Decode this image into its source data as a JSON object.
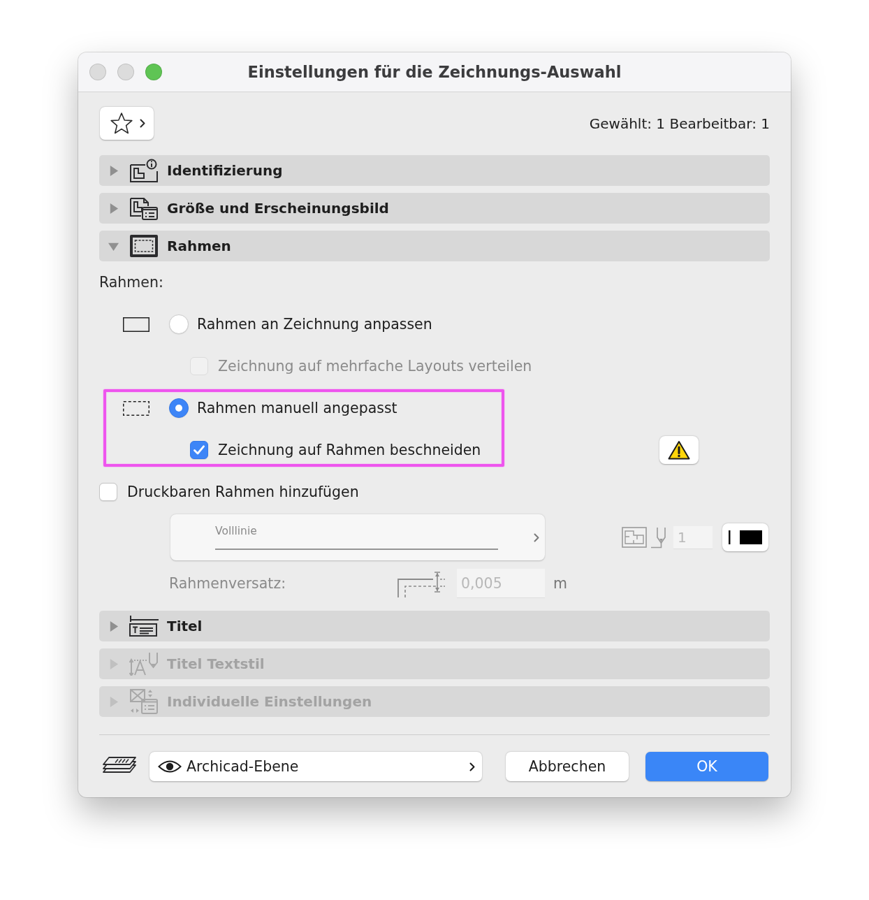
{
  "window": {
    "title": "Einstellungen für die Zeichnungs-Auswahl",
    "controls": [
      {
        "kind": "close",
        "disabled": true
      },
      {
        "kind": "minimize",
        "disabled": true
      },
      {
        "kind": "zoom",
        "disabled": false
      }
    ]
  },
  "toolbar": {
    "selection_count": "Gewählt: 1 Bearbeitbar: 1"
  },
  "sections": [
    {
      "kind": "identification",
      "title": "Identifizierung",
      "expanded": false,
      "disabled": false
    },
    {
      "kind": "appearance",
      "title": "Größe und Erscheinungsbild",
      "expanded": false,
      "disabled": false
    },
    {
      "kind": "frame",
      "title": "Rahmen",
      "expanded": true,
      "disabled": false,
      "content": {
        "label": "Rahmen:",
        "options": [
          {
            "kind": "solid",
            "label": "Rahmen an Zeichnung anpassen",
            "selected": false,
            "highlighted": false,
            "sub_option": {
              "label": "Zeichnung auf mehrfache Layouts verteilen",
              "checked": false,
              "disabled": true,
              "warning": false
            }
          },
          {
            "kind": "dashed",
            "label": "Rahmen manuell angepasst",
            "selected": true,
            "highlighted": true,
            "sub_option": {
              "label": "Zeichnung auf Rahmen beschneiden",
              "checked": true,
              "disabled": false,
              "warning": true
            }
          }
        ],
        "printable_frame": {
          "label": "Druckbaren Rahmen hinzufügen",
          "checked": false
        },
        "line_type": {
          "value": "Volllinie",
          "disabled": true
        },
        "pen": {
          "value": "1",
          "disabled": true
        },
        "offset": {
          "label": "Rahmenversatz:",
          "value": "0,005",
          "unit": "m",
          "disabled": true
        }
      }
    },
    {
      "kind": "title",
      "title": "Titel",
      "expanded": false,
      "disabled": false
    },
    {
      "kind": "textstyle",
      "title": "Titel Textstil",
      "expanded": false,
      "disabled": true
    },
    {
      "kind": "custom",
      "title": "Individuelle Einstellungen",
      "expanded": false,
      "disabled": true
    }
  ],
  "footer": {
    "layer": "Archicad-Ebene",
    "buttons": [
      {
        "kind": "cancel",
        "label": "Abbrechen"
      },
      {
        "kind": "confirm",
        "label": "OK"
      }
    ]
  }
}
